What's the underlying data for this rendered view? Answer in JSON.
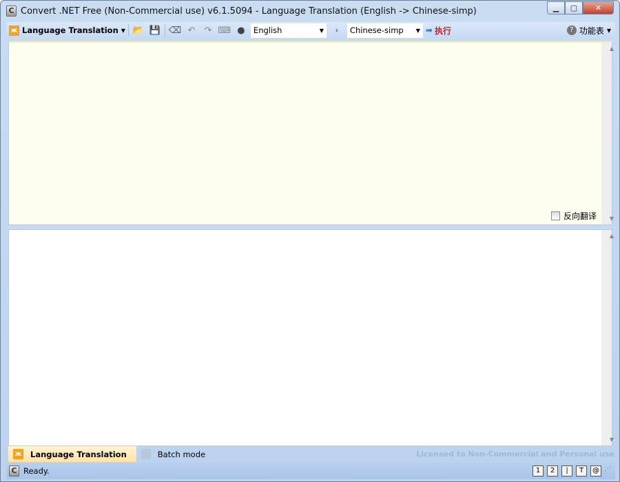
{
  "window": {
    "title": "Convert .NET Free (Non-Commercial use) v6.1.5094 - Language Translation (English -> Chinese-simp)",
    "app_icon_letter": "C"
  },
  "toolbar": {
    "mode_label": "Language Translation",
    "source_lang": "English",
    "separator": "›",
    "target_lang": "Chinese-simp",
    "execute_label": "执行",
    "help_label": "功能表"
  },
  "input_pane": {
    "text": "",
    "reverse_label": "反向翻译",
    "reverse_checked": false
  },
  "output_pane": {
    "text": ""
  },
  "tabs": [
    {
      "label": "Language Translation",
      "active": true
    },
    {
      "label": "Batch mode",
      "active": false
    }
  ],
  "license_text": "Licensed to Non-Commercial and Personal use",
  "status": {
    "text": "Ready.",
    "buttons": [
      "1",
      "2",
      "|",
      "T",
      "@"
    ]
  }
}
